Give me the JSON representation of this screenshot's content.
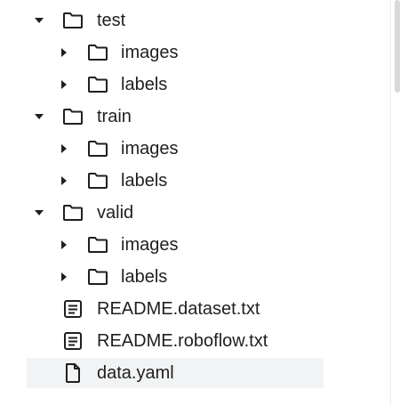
{
  "file_tree": {
    "items": [
      {
        "label": "test",
        "kind": "folder",
        "state": "expanded",
        "depth": 0
      },
      {
        "label": "images",
        "kind": "folder",
        "state": "collapsed",
        "depth": 1
      },
      {
        "label": "labels",
        "kind": "folder",
        "state": "collapsed",
        "depth": 1
      },
      {
        "label": "train",
        "kind": "folder",
        "state": "expanded",
        "depth": 0
      },
      {
        "label": "images",
        "kind": "folder",
        "state": "collapsed",
        "depth": 1
      },
      {
        "label": "labels",
        "kind": "folder",
        "state": "collapsed",
        "depth": 1
      },
      {
        "label": "valid",
        "kind": "folder",
        "state": "expanded",
        "depth": 0
      },
      {
        "label": "images",
        "kind": "folder",
        "state": "collapsed",
        "depth": 1
      },
      {
        "label": "labels",
        "kind": "folder",
        "state": "collapsed",
        "depth": 1
      },
      {
        "label": "README.dataset.txt",
        "kind": "text-file",
        "depth": 0
      },
      {
        "label": "README.roboflow.txt",
        "kind": "text-file",
        "depth": 0
      },
      {
        "label": "data.yaml",
        "kind": "file",
        "depth": 0,
        "selected": true
      }
    ]
  },
  "icons": {
    "expanded": "caret-down-icon",
    "collapsed": "caret-right-icon",
    "folder": "folder-icon",
    "text_file": "text-file-icon",
    "file": "file-icon"
  },
  "colors": {
    "icon": "#1f1f1f",
    "text": "#1f1f1f",
    "selected_row": "#f1f3f4",
    "scrollbar_thumb": "#d9d9d9"
  }
}
